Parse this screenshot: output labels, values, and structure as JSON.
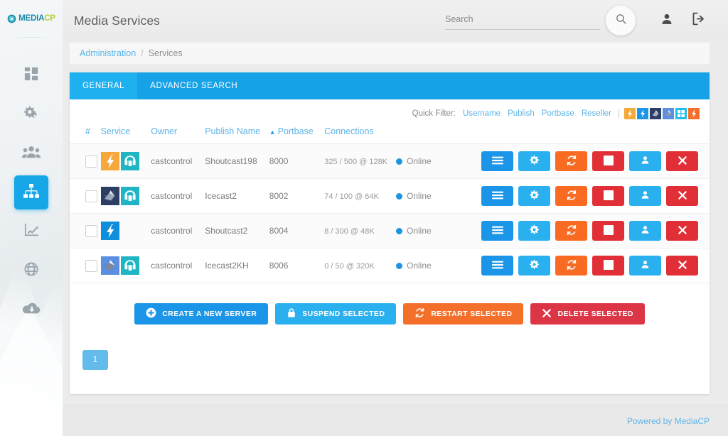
{
  "brand": {
    "name_main": "MEDIA",
    "name_accent": "CP",
    "logo_icon": "disc-icon"
  },
  "sidebar": {
    "items": [
      {
        "icon": "dashboard-grid-icon",
        "name": "dashboard",
        "active": false
      },
      {
        "icon": "gears-settings-icon",
        "name": "settings",
        "active": false
      },
      {
        "icon": "users-group-icon",
        "name": "clients",
        "active": false
      },
      {
        "icon": "sitemap-network-icon",
        "name": "services",
        "active": true
      },
      {
        "icon": "line-chart-icon",
        "name": "statistics",
        "active": false
      },
      {
        "icon": "globe-icon",
        "name": "network",
        "active": false
      },
      {
        "icon": "cloud-download-icon",
        "name": "downloads",
        "active": false
      }
    ]
  },
  "header": {
    "title": "Media Services",
    "search": {
      "placeholder": "Search",
      "value": ""
    },
    "search_button_icon": "search-icon",
    "account_icon": "person-icon",
    "logout_icon": "logout-icon"
  },
  "breadcrumb": {
    "root": "Administration",
    "separator": "/",
    "current": "Services"
  },
  "tabs": [
    {
      "label": "GENERAL",
      "active": true
    },
    {
      "label": "ADVANCED SEARCH",
      "active": false
    }
  ],
  "quick_filter": {
    "label": "Quick Filter:",
    "links": [
      "Username",
      "Publish",
      "Portbase",
      "Reseller"
    ],
    "pipe": "|",
    "icons": [
      {
        "name": "shoutcast-v1-filter-icon",
        "color": "#f5a83c"
      },
      {
        "name": "shoutcast-v2-filter-icon",
        "color": "#1b95e8"
      },
      {
        "name": "icecast-v2-filter-icon",
        "color": "#2c3e63"
      },
      {
        "name": "icecast-kh-filter-icon",
        "color": "#5b8fe0"
      },
      {
        "name": "windows-media-filter-icon",
        "color": "#20bdf0"
      },
      {
        "name": "all-services-filter-icon",
        "color": "#f4702a"
      }
    ]
  },
  "table": {
    "columns": [
      "#",
      "Service",
      "Owner",
      "Publish Name",
      "Portbase",
      "Connections"
    ],
    "sorted_column": "Portbase",
    "sort_direction": "asc",
    "sort_caret": "▲",
    "rows": [
      {
        "checked": false,
        "service_icons": [
          {
            "name": "shoutcast-v1-icon",
            "color": "#f5a83c"
          },
          {
            "name": "headphones-autodj-icon",
            "color": "#1fb5c4"
          }
        ],
        "owner": "castcontrol",
        "publish_name": "Shoutcast198",
        "portbase": "8000",
        "connections": "325 / 500 @ 128K",
        "status": "Online"
      },
      {
        "checked": false,
        "service_icons": [
          {
            "name": "icecast-v2-icon",
            "color": "#2c3e63"
          },
          {
            "name": "headphones-autodj-icon",
            "color": "#1fb5c4"
          }
        ],
        "owner": "castcontrol",
        "publish_name": "Icecast2",
        "portbase": "8002",
        "connections": "74 / 100 @ 64K",
        "status": "Online"
      },
      {
        "checked": false,
        "service_icons": [
          {
            "name": "shoutcast-v2-icon",
            "color": "#0f8fdb"
          }
        ],
        "owner": "castcontrol",
        "publish_name": "Shoutcast2",
        "portbase": "8004",
        "connections": "8 / 300 @ 48K",
        "status": "Online"
      },
      {
        "checked": false,
        "service_icons": [
          {
            "name": "icecast-kh-icon",
            "color": "#5b8fe0"
          },
          {
            "name": "headphones-autodj-icon",
            "color": "#1fb5c4"
          }
        ],
        "owner": "castcontrol",
        "publish_name": "Icecast2KH",
        "portbase": "8006",
        "connections": "0 / 50 @ 320K",
        "status": "Online"
      }
    ],
    "row_actions": [
      {
        "name": "details-menu-button",
        "icon": "hamburger-icon",
        "class": "b-menu"
      },
      {
        "name": "configure-button",
        "icon": "gear-icon",
        "class": "b-gear"
      },
      {
        "name": "restart-button",
        "icon": "refresh-icon",
        "class": "b-restart"
      },
      {
        "name": "stop-button",
        "icon": "stop-square-icon",
        "class": "b-stop"
      },
      {
        "name": "login-as-user-button",
        "icon": "person-icon",
        "class": "b-user"
      },
      {
        "name": "delete-button",
        "icon": "close-x-icon",
        "class": "b-del"
      }
    ]
  },
  "bulk_actions": [
    {
      "label": "CREATE A NEW SERVER",
      "icon": "plus-circle-icon",
      "class": "create"
    },
    {
      "label": "SUSPEND SELECTED",
      "icon": "lock-icon",
      "class": "suspend"
    },
    {
      "label": "RESTART SELECTED",
      "icon": "refresh-icon",
      "class": "restart"
    },
    {
      "label": "DELETE SELECTED",
      "icon": "close-x-icon",
      "class": "delete"
    }
  ],
  "pagination": {
    "pages": [
      "1"
    ],
    "current": "1"
  },
  "footer": {
    "text": "Powered by MediaCP"
  }
}
